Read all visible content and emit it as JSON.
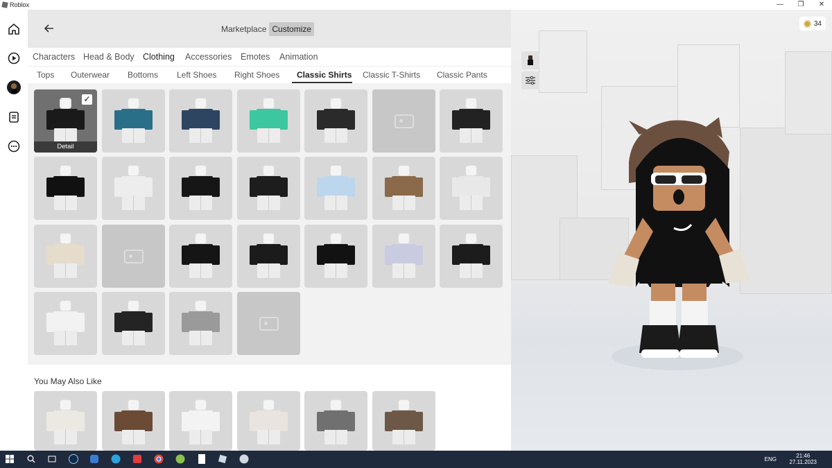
{
  "window": {
    "title": "Roblox",
    "controls": [
      "—",
      "❐",
      "✕"
    ]
  },
  "sidebar": {
    "items": [
      "home-icon",
      "play-icon",
      "avatar",
      "chat-icon",
      "more-icon"
    ]
  },
  "header": {
    "back_icon": "arrow-left-icon",
    "tabs": [
      {
        "label": "Marketplace",
        "active": false
      },
      {
        "label": "Customize",
        "active": true
      }
    ]
  },
  "categories": [
    {
      "label": "Characters",
      "active": false
    },
    {
      "label": "Head & Body",
      "active": false
    },
    {
      "label": "Clothing",
      "active": true
    },
    {
      "label": "Accessories",
      "active": false
    },
    {
      "label": "Emotes",
      "active": false
    },
    {
      "label": "Animation",
      "active": false
    }
  ],
  "subcategories": [
    {
      "label": "Tops",
      "active": false
    },
    {
      "label": "Outerwear",
      "active": false
    },
    {
      "label": "Bottoms",
      "active": false
    },
    {
      "label": "Left Shoes",
      "active": false
    },
    {
      "label": "Right Shoes",
      "active": false
    },
    {
      "label": "Classic Shirts",
      "active": true
    },
    {
      "label": "Classic T-Shirts",
      "active": false
    },
    {
      "label": "Classic Pants",
      "active": false
    }
  ],
  "items": [
    {
      "kind": "shirt",
      "color": "#1a1a1a",
      "selected": true,
      "label": "Detail"
    },
    {
      "kind": "shirt",
      "color": "#2a6f88"
    },
    {
      "kind": "shirt",
      "color": "#2d4560"
    },
    {
      "kind": "shirt",
      "color": "#3cc7a0"
    },
    {
      "kind": "shirt",
      "color": "#2a2a2a"
    },
    {
      "kind": "placeholder"
    },
    {
      "kind": "shirt",
      "color": "#222222"
    },
    {
      "kind": "shirt",
      "color": "#111111"
    },
    {
      "kind": "shirt",
      "color": "#ededed"
    },
    {
      "kind": "shirt",
      "color": "#161616"
    },
    {
      "kind": "shirt",
      "color": "#1d1d1d"
    },
    {
      "kind": "shirt",
      "color": "#bcd6ee"
    },
    {
      "kind": "shirt",
      "color": "#8a6a4b"
    },
    {
      "kind": "shirt",
      "color": "#e8e8e8"
    },
    {
      "kind": "shirt",
      "color": "#e6dccb"
    },
    {
      "kind": "placeholder"
    },
    {
      "kind": "shirt",
      "color": "#151515"
    },
    {
      "kind": "shirt",
      "color": "#1b1b1b"
    },
    {
      "kind": "shirt",
      "color": "#121212"
    },
    {
      "kind": "shirt",
      "color": "#c9cbe0"
    },
    {
      "kind": "shirt",
      "color": "#1c1c1c"
    },
    {
      "kind": "shirt",
      "color": "#f2f2f2"
    },
    {
      "kind": "shirt",
      "color": "#242424"
    },
    {
      "kind": "shirt",
      "color": "#9a9a9a"
    },
    {
      "kind": "placeholder"
    }
  ],
  "recommendations": {
    "title": "You May Also Like",
    "items": [
      {
        "color": "#ece9e3"
      },
      {
        "color": "#6b4a36"
      },
      {
        "color": "#f3f3f3"
      },
      {
        "color": "#e9e4df"
      },
      {
        "color": "#707070"
      },
      {
        "color": "#6d5848"
      }
    ]
  },
  "viewport": {
    "robux": "34",
    "buttons": [
      "head-view-icon",
      "sliders-icon"
    ]
  },
  "taskbar": {
    "lang": "ENG",
    "time": "21:46",
    "date": "27.11.2023"
  }
}
